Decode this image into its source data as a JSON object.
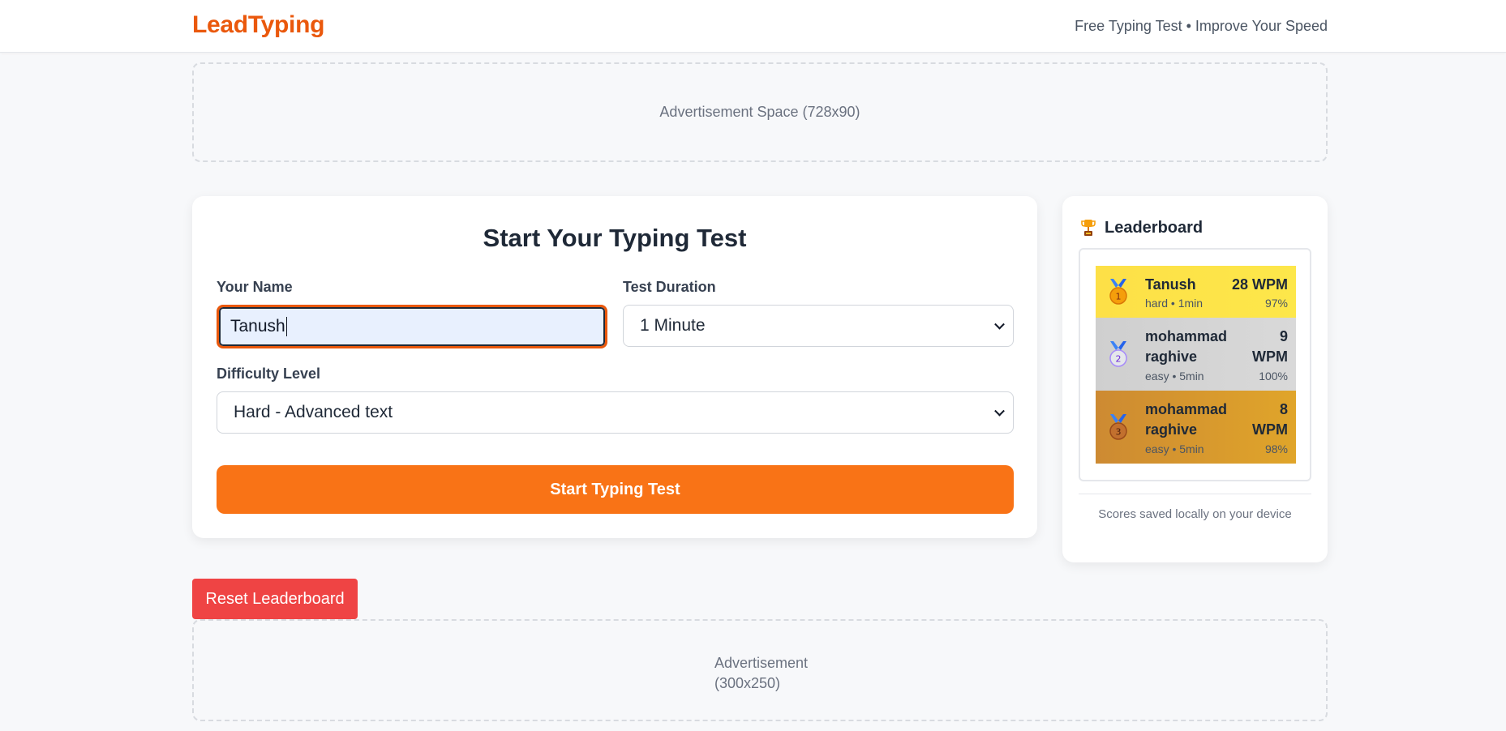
{
  "header": {
    "logo": "LeadTyping",
    "tagline": "Free Typing Test • Improve Your Speed"
  },
  "ads": {
    "top": "Advertisement Space (728x90)",
    "bottom_line1": "Advertisement",
    "bottom_line2": "(300x250)"
  },
  "form": {
    "title": "Start Your Typing Test",
    "name_label": "Your Name",
    "name_value": "Tanush",
    "duration_label": "Test Duration",
    "duration_value": "1 Minute",
    "difficulty_label": "Difficulty Level",
    "difficulty_value": "Hard - Advanced text",
    "start_button": "Start Typing Test"
  },
  "leaderboard": {
    "title": "Leaderboard",
    "icon": "trophy-icon",
    "entries": [
      {
        "rank": 1,
        "name": "Tanush",
        "meta": "hard • 1min",
        "wpm": "28 WPM",
        "accuracy": "97%",
        "color": "#fde047"
      },
      {
        "rank": 2,
        "name_line1": "mohammad",
        "name_line2": "raghive",
        "meta": "easy • 5min",
        "wpm_line1": "9",
        "wpm_line2": "WPM",
        "accuracy": "100%",
        "color": "#d1d5db"
      },
      {
        "rank": 3,
        "name_line1": "mohammad",
        "name_line2": "raghive",
        "meta": "easy • 5min",
        "wpm_line1": "8",
        "wpm_line2": "WPM",
        "accuracy": "98%",
        "color": "#d4952b"
      }
    ],
    "note": "Scores saved locally on your device"
  },
  "reset_button": "Reset Leaderboard",
  "colors": {
    "accent": "#f97316",
    "logo": "#ea580c",
    "danger": "#ef4444"
  }
}
